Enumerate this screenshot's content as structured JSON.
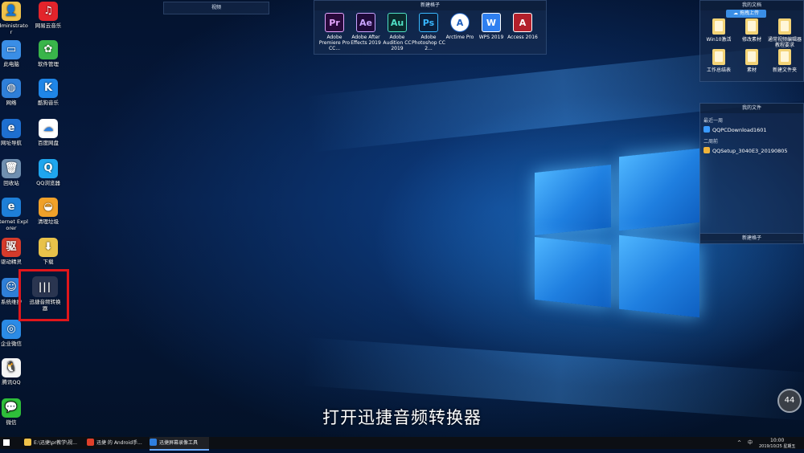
{
  "desktop_icons": [
    {
      "label": "Administrator",
      "color": "#f0c24a",
      "glyph": "👤"
    },
    {
      "label": "网易云音乐",
      "color": "#e3242b",
      "glyph": "♫"
    },
    {
      "label": "此电脑",
      "color": "#3a8ee6",
      "glyph": "▭"
    },
    {
      "label": "软件管理",
      "color": "#39b54a",
      "glyph": "✿"
    },
    {
      "label": "网络",
      "color": "#2f7fd8",
      "glyph": "◍"
    },
    {
      "label": "酷狗音乐",
      "color": "#1f86e8",
      "glyph": "K"
    },
    {
      "label": "网址导航",
      "color": "#1e6fd0",
      "glyph": "e"
    },
    {
      "label": "百度网盘",
      "color": "#ffffff",
      "glyph": "☁"
    },
    {
      "label": "回收站",
      "color": "#6f8fb0",
      "glyph": "🗑"
    },
    {
      "label": "QQ浏览器",
      "color": "#1fa6ee",
      "glyph": "Q"
    },
    {
      "label": "Internet Explorer",
      "color": "#1e7fd8",
      "glyph": "e"
    },
    {
      "label": "清理垃圾",
      "color": "#f0a12a",
      "glyph": "◒"
    },
    {
      "label": "驱动精灵",
      "color": "#d63b2b",
      "glyph": "驱"
    },
    {
      "label": "下载",
      "color": "#e8c24a",
      "glyph": "⬇"
    },
    {
      "label": "系统维护",
      "color": "#2f7fd8",
      "glyph": "☺"
    },
    {
      "label": "迅捷音频转换器",
      "color": "#2a3550",
      "glyph": "|||"
    },
    {
      "label": "企业微信",
      "color": "#2b8be6",
      "glyph": "◎"
    },
    {
      "label": "腾讯QQ",
      "color": "#f5f5f5",
      "glyph": "🐧"
    },
    {
      "label": "微信",
      "color": "#2fbf3a",
      "glyph": "💬"
    }
  ],
  "fence_video": {
    "title": "视频"
  },
  "fence_new_top": {
    "title": "新建格子",
    "apps": [
      {
        "label": "Adobe Premiere Pro CC...",
        "abbr": "Pr",
        "bg": "#2a0a3c",
        "fg": "#e6a6ff"
      },
      {
        "label": "Adobe After Effects 2019",
        "abbr": "Ae",
        "bg": "#1f0a3a",
        "fg": "#c9a4ff"
      },
      {
        "label": "Adobe Audition CC 2019",
        "abbr": "Au",
        "bg": "#0a2a2c",
        "fg": "#4fe0c4"
      },
      {
        "label": "Adobe Photoshop CC 2...",
        "abbr": "Ps",
        "bg": "#0a1f3c",
        "fg": "#39b8ff"
      },
      {
        "label": "Arctime Pro",
        "abbr": "A",
        "bg": "#ffffff",
        "fg": "#1d5fbf"
      },
      {
        "label": "WPS 2019",
        "abbr": "W",
        "bg": "#2f7ff0",
        "fg": "#ffffff"
      },
      {
        "label": "Access 2016",
        "abbr": "A",
        "bg": "#b3202c",
        "fg": "#ffffff"
      }
    ]
  },
  "fence_mydoc": {
    "title": "我的文档",
    "badge": "拖拽上传",
    "folders": [
      {
        "label": "Win10激活"
      },
      {
        "label": "修改素材"
      },
      {
        "label": "通常视频编辑器教程要求"
      },
      {
        "label": "工作总结表"
      },
      {
        "label": "素材"
      },
      {
        "label": "新建文件夹"
      }
    ]
  },
  "fence_myfiles": {
    "title": "我的文件",
    "section_recent": "最近一周",
    "recent": [
      {
        "name": "QQPCDownload1601",
        "color": "#3a9bff"
      }
    ],
    "section_twoweeks": "二周前",
    "older": [
      {
        "name": "QQSetup_3040E3_20190805",
        "color": "#f0b43a"
      }
    ]
  },
  "fence_new_bottom": {
    "title": "新建格子"
  },
  "subtitle": "打开迅捷音频转换器",
  "clock_bubble": "44",
  "taskbar": {
    "items": [
      {
        "label": "E:\\迅捷\\pr教学\\视...",
        "color": "#f0c24a",
        "active": false
      },
      {
        "label": "迅捷 的 Android手...",
        "color": "#e0402a",
        "active": false
      },
      {
        "label": "迅捷屏幕录像工具",
        "color": "#2f7fe0",
        "active": true
      }
    ],
    "time": "10:00",
    "date": "2019/10/25 星期五",
    "ime": "中"
  }
}
